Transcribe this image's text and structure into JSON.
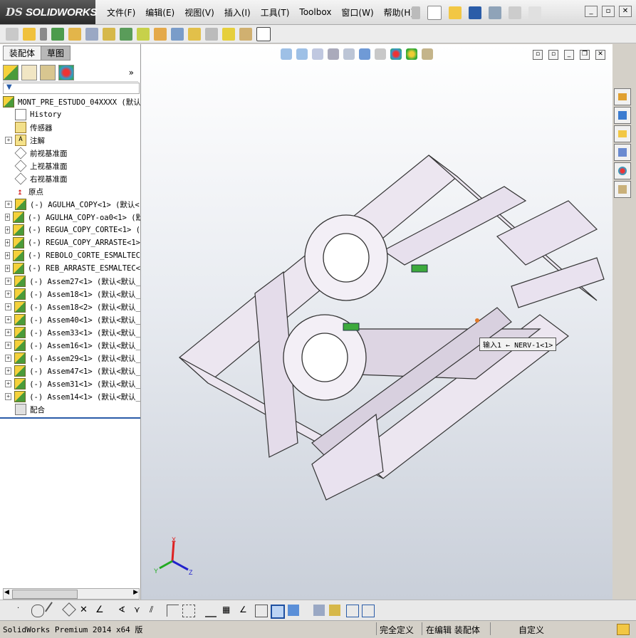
{
  "app": {
    "logo_prefix": "DS",
    "logo_name": "SOLIDWORKS"
  },
  "menu": [
    "文件(F)",
    "编辑(E)",
    "视图(V)",
    "插入(I)",
    "工具(T)",
    "Toolbox",
    "窗口(W)",
    "帮助(H)"
  ],
  "panel": {
    "tabs": [
      "装配体",
      "草图"
    ],
    "active_tab": "草图",
    "more": "»"
  },
  "tree": [
    {
      "label": "MONT_PRE_ESTUDO_04XXXX  (默认<",
      "icon": "assembly-icon",
      "indent": 0,
      "expand": false
    },
    {
      "label": "History",
      "icon": "history-icon",
      "indent": 1,
      "expand": false
    },
    {
      "label": "传感器",
      "icon": "sensor-icon",
      "indent": 1,
      "expand": false
    },
    {
      "label": "注解",
      "icon": "annotation-icon",
      "indent": 1,
      "expand": true
    },
    {
      "label": "前视基准面",
      "icon": "plane-icon",
      "indent": 1,
      "expand": false
    },
    {
      "label": "上视基准面",
      "icon": "plane-icon",
      "indent": 1,
      "expand": false
    },
    {
      "label": "右视基准面",
      "icon": "plane-icon",
      "indent": 1,
      "expand": false
    },
    {
      "label": "原点",
      "icon": "origin-icon",
      "indent": 1,
      "expand": false
    },
    {
      "label": "(-) AGULHA_COPY<1> (默认<",
      "icon": "subassembly-icon",
      "indent": 1,
      "expand": true
    },
    {
      "label": "(-) AGULHA_COPY-oa0<1> (默",
      "icon": "subassembly-icon",
      "indent": 1,
      "expand": true
    },
    {
      "label": "(-) REGUA_COPY_CORTE<1> (",
      "icon": "subassembly-icon",
      "indent": 1,
      "expand": true
    },
    {
      "label": "(-) REGUA_COPY_ARRASTE<1>",
      "icon": "subassembly-icon",
      "indent": 1,
      "expand": true
    },
    {
      "label": "(-) REBOLO_CORTE_ESMALTEC",
      "icon": "subassembly-icon",
      "indent": 1,
      "expand": true
    },
    {
      "label": "(-) REB_ARRASTE_ESMALTEC<",
      "icon": "subassembly-icon",
      "indent": 1,
      "expand": true
    },
    {
      "label": "(-) Assem27<1> (默认<默认_",
      "icon": "subassembly-icon",
      "indent": 1,
      "expand": true
    },
    {
      "label": "(-) Assem18<1> (默认<默认_",
      "icon": "subassembly-icon",
      "indent": 1,
      "expand": true
    },
    {
      "label": "(-) Assem18<2> (默认<默认_",
      "icon": "subassembly-icon",
      "indent": 1,
      "expand": true
    },
    {
      "label": "(-) Assem40<1> (默认<默认_",
      "icon": "subassembly-icon",
      "indent": 1,
      "expand": true
    },
    {
      "label": "(-) Assem33<1> (默认<默认_",
      "icon": "subassembly-icon",
      "indent": 1,
      "expand": true
    },
    {
      "label": "(-) Assem16<1> (默认<默认_",
      "icon": "subassembly-icon",
      "indent": 1,
      "expand": true
    },
    {
      "label": "(-) Assem29<1> (默认<默认_",
      "icon": "subassembly-icon",
      "indent": 1,
      "expand": true
    },
    {
      "label": "(-) Assem47<1> (默认<默认_",
      "icon": "subassembly-icon",
      "indent": 1,
      "expand": true
    },
    {
      "label": "(-) Assem31<1> (默认<默认_",
      "icon": "subassembly-icon",
      "indent": 1,
      "expand": true
    },
    {
      "label": "(-) Assem14<1> (默认<默认_",
      "icon": "subassembly-icon",
      "indent": 1,
      "expand": true
    },
    {
      "label": "配合",
      "icon": "mates-icon",
      "indent": 1,
      "expand": false
    }
  ],
  "viewport": {
    "callout": "输入1 ← NERV-1<1>",
    "triad": {
      "x": "X",
      "y": "Y",
      "z": "Z"
    }
  },
  "status": {
    "app_version": "SolidWorks Premium 2014 x64 版",
    "definition": "完全定义",
    "editing": "在编辑 装配体",
    "units": "自定义"
  },
  "colors": {
    "viewport_top": "#ffffff",
    "viewport_bottom": "#c9cfd9",
    "model": "#ece6f0",
    "model_edge": "#333333",
    "accent_green": "#3caa3c"
  }
}
